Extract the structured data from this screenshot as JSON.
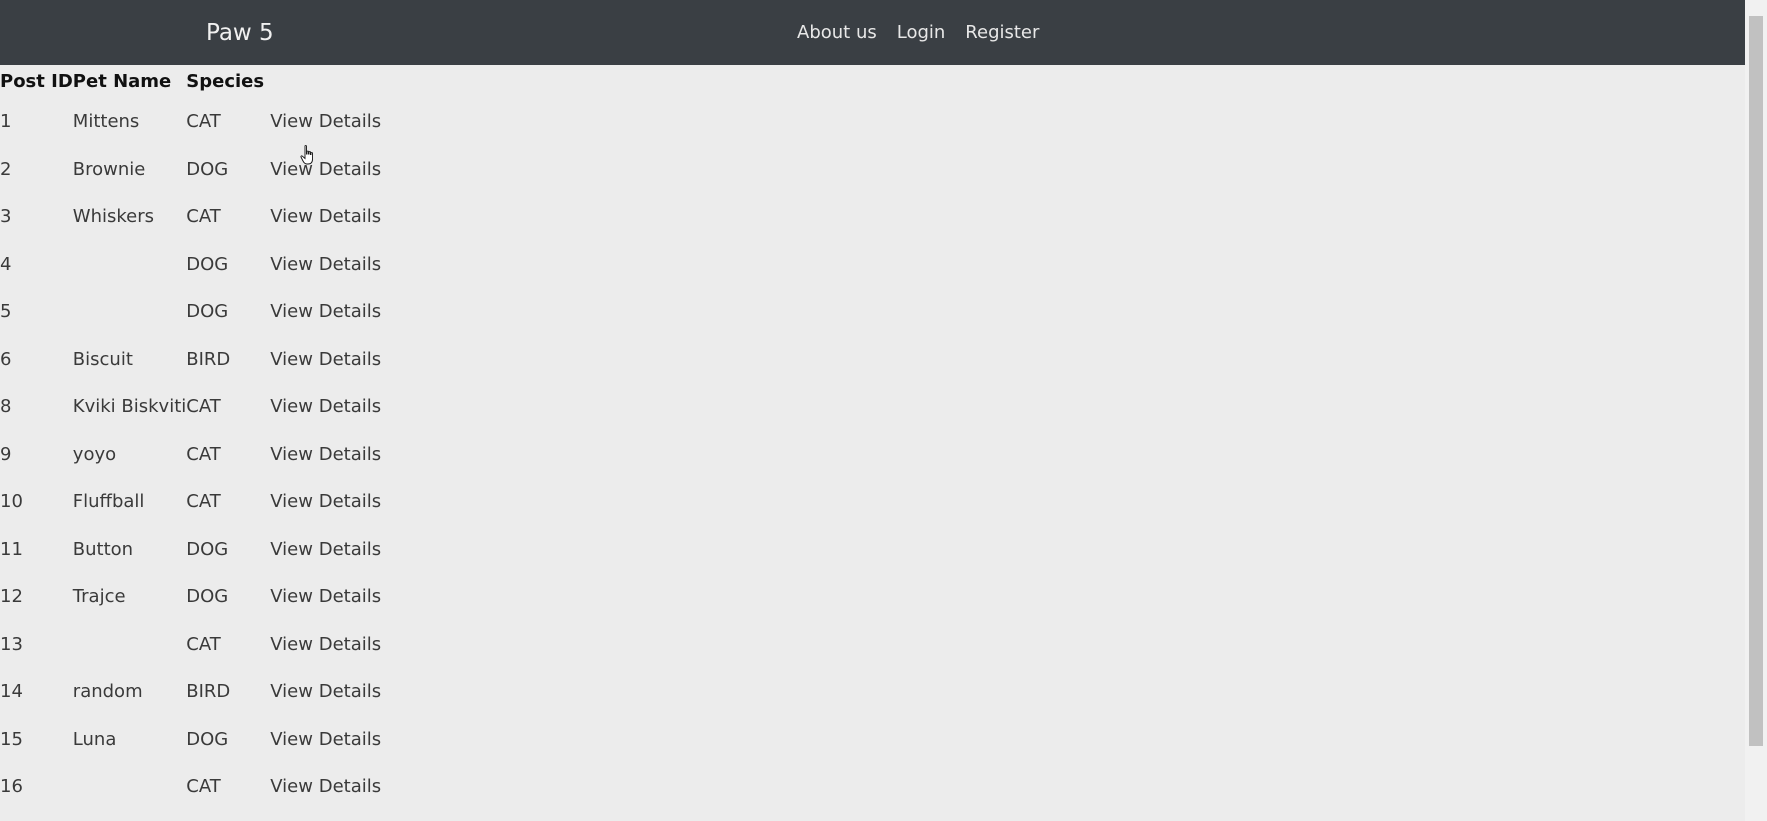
{
  "navbar": {
    "brand": "Paw 5",
    "links": [
      "About us",
      "Login",
      "Register"
    ]
  },
  "table": {
    "headers": [
      "Post ID",
      "Pet Name",
      "Species"
    ],
    "rows": [
      {
        "id": "1",
        "name": "Mittens",
        "species": "CAT",
        "action": "View Details"
      },
      {
        "id": "2",
        "name": "Brownie",
        "species": "DOG",
        "action": "View Details"
      },
      {
        "id": "3",
        "name": "Whiskers",
        "species": "CAT",
        "action": "View Details"
      },
      {
        "id": "4",
        "name": "",
        "species": "DOG",
        "action": "View Details"
      },
      {
        "id": "5",
        "name": "",
        "species": "DOG",
        "action": "View Details"
      },
      {
        "id": "6",
        "name": "Biscuit",
        "species": "BIRD",
        "action": "View Details"
      },
      {
        "id": "8",
        "name": "Kviki Biskviti",
        "species": "CAT",
        "action": "View Details"
      },
      {
        "id": "9",
        "name": "yoyo",
        "species": "CAT",
        "action": "View Details"
      },
      {
        "id": "10",
        "name": "Fluffball",
        "species": "CAT",
        "action": "View Details"
      },
      {
        "id": "11",
        "name": "Button",
        "species": "DOG",
        "action": "View Details"
      },
      {
        "id": "12",
        "name": "Trajce",
        "species": "DOG",
        "action": "View Details"
      },
      {
        "id": "13",
        "name": "",
        "species": "CAT",
        "action": "View Details"
      },
      {
        "id": "14",
        "name": "random",
        "species": "BIRD",
        "action": "View Details"
      },
      {
        "id": "15",
        "name": "Luna",
        "species": "DOG",
        "action": "View Details"
      },
      {
        "id": "16",
        "name": "",
        "species": "CAT",
        "action": "View Details"
      }
    ]
  },
  "icons": {
    "cursor": "hand-pointer-icon"
  },
  "colors": {
    "navbar_bg": "#3a3f44",
    "page_bg": "#ececec"
  }
}
